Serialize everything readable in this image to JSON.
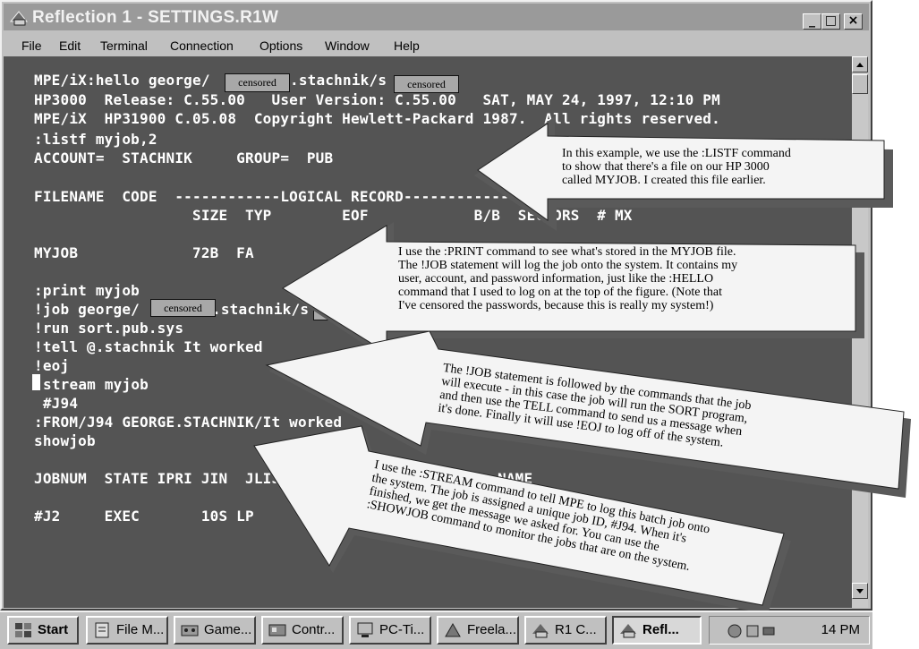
{
  "window": {
    "title": "Reflection 1 - SETTINGS.R1W",
    "minimize_glyph": "_",
    "maximize_glyph": "□",
    "close_glyph": "×"
  },
  "menu": [
    "File",
    "Edit",
    "Terminal",
    "Connection",
    "Options",
    "Window",
    "Help"
  ],
  "terminal": {
    "lines": [
      "MPE/iX:hello george/",
      "HP3000  Release: C.55.00   User Version: C.55.00   SAT, MAY 24, 1997, 12:10 PM",
      "MPE/iX  HP31900 C.05.08  Copyright Hewlett-Packard 1987.  All rights reserved.",
      ":listf myjob,2",
      "ACCOUNT=  STACHNIK     GROUP=  PUB",
      "",
      "FILENAME  CODE  ------------LOGICAL RECORD------------",
      "                  SIZE  TYP        EOF            B/B  SECTORS  # MX",
      "",
      "MYJOB             72B  FA",
      "",
      ":print myjob",
      "!job george/",
      "!run sort.pub.sys",
      "!tell @.stachnik It worked",
      "!eoj",
      "stream myjob",
      " #J94",
      ":FROM/J94 GEORGE.STACHNIK/It worked",
      "showjob",
      "",
      "JOBNUM  STATE IPRI JIN  JLIST",
      "",
      "#J2     EXEC       10S LP"
    ],
    "hello_suffix": ".stachnik/s",
    "job_suffix": ".stachnik/s",
    "jobname_header": "NAME",
    "censored_label": "censored",
    "censored_partial": "cens"
  },
  "callouts": {
    "listf": [
      "In this example, we use the :LISTF command",
      "to show that there's a file on our HP 3000",
      "called MYJOB.  I created this file earlier."
    ],
    "print": [
      "I use the :PRINT command to see what's stored in the MYJOB file.",
      "The !JOB statement will log the job onto the system.  It contains my",
      "user, account, and password information, just like the :HELLO",
      "command that I used to log on at the top of the figure.  (Note that",
      "I've censored the passwords, because this is really my system!)"
    ],
    "job": [
      "The !JOB statement is followed by the commands that the job",
      "will execute - in this case the job will run the SORT program,",
      "and then use the TELL command to send us a message when",
      "it's done.  Finally it will use !EOJ to log off of the system."
    ],
    "stream": [
      "I use the :STREAM command to tell MPE to log this batch job onto",
      "the system.  The job is assigned a unique job ID, #J94.  When it's",
      "finished, we get the message we asked for.  You can use the",
      ":SHOWJOB command to monitor the jobs that are on the system."
    ]
  },
  "taskbar": {
    "start": "Start",
    "items": [
      "File M...",
      "Game...",
      "Contr...",
      "PC-Ti...",
      "Freela...",
      "R1 C...",
      "Refl..."
    ],
    "clock": "14 PM"
  }
}
